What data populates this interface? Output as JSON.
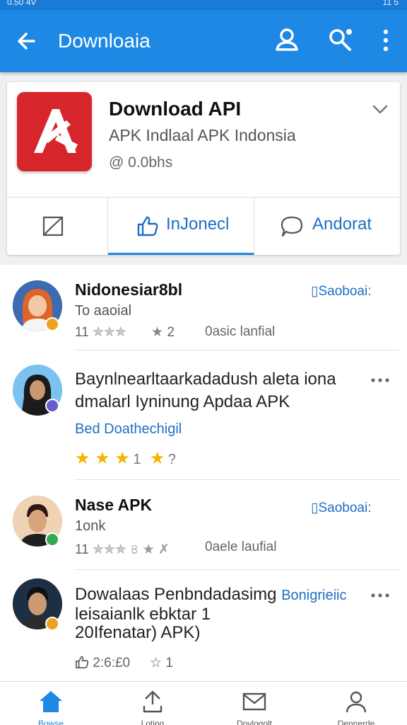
{
  "status_bar": {
    "time": "0.50",
    "carrier": "4V",
    "right": "11 5"
  },
  "app_bar": {
    "title": "Downloaia"
  },
  "app_card": {
    "name": "Download API",
    "subtitle": "APK Indlaal APK Indonsia",
    "meta": "@ 0.0bhs",
    "tabs": [
      {
        "label": "",
        "icon": "bookmark-icon"
      },
      {
        "label": "InJonecl",
        "icon": "thumbs-up-icon"
      },
      {
        "label": "Andorat",
        "icon": "chat-bubble-icon"
      }
    ]
  },
  "feed": [
    {
      "title": "Nidonesiar8bl",
      "sub": "To aaoial",
      "stat_left": "11",
      "stat_mid": "2",
      "stat_right": "0asic lanfial",
      "action": "Saoboai:",
      "badge_color": "#f0a020"
    },
    {
      "text_line1": "Baynlnearltaarkadadush aleta iona",
      "text_line2": "dmalarl Iyninung Apdaa APK",
      "link": "Bed Doathechigil",
      "rating": "1",
      "rating2": "?",
      "badge_color": "#6a5acd"
    },
    {
      "title": "Nase APK",
      "sub": "1onk",
      "stat_left": "11",
      "stat_right": "0aele laufial",
      "action": "Saoboai:",
      "badge_color": "#34a853"
    },
    {
      "text_line1_a": "Dowalaas Penbndadasimg",
      "text_line1_b": "Bonigrieiic",
      "text_line2": "leisaianlk ebktar 1",
      "text_line3": "20Ifenatar) APK)",
      "like_count": "2:6:£0",
      "star_count": "1",
      "badge_color": "#f0a020"
    }
  ],
  "bottom_nav": [
    {
      "label": "Bowse",
      "icon": "home-icon"
    },
    {
      "label": "Loting",
      "icon": "upload-icon"
    },
    {
      "label": "Dovlogolt",
      "icon": "mail-icon"
    },
    {
      "label": "Dennerde",
      "icon": "profile-icon"
    }
  ],
  "colors": {
    "primary": "#1e88e5",
    "logo_red": "#d7262b",
    "star": "#f4b400"
  }
}
